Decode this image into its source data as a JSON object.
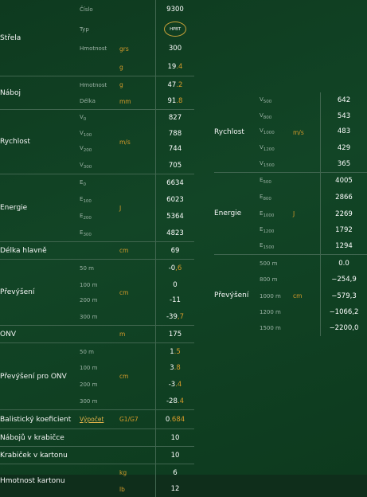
{
  "left": {
    "projectile": {
      "label": "Střela",
      "rows": [
        {
          "param": "Číslo",
          "unit": "",
          "value": "9300"
        },
        {
          "param": "Typ",
          "unit": "",
          "badge": "HPBT"
        },
        {
          "param": "Hmotnost",
          "unit": "grs",
          "value": "300"
        },
        {
          "param": "",
          "unit": "g",
          "int": "19",
          "dec": ".4"
        }
      ]
    },
    "cartridge": {
      "label": "Náboj",
      "rows": [
        {
          "param": "Hmotnost",
          "unit": "g",
          "int": "47",
          "dec": ".2"
        },
        {
          "param": "Délka",
          "unit": "mm",
          "int": "91",
          "dec": ".8"
        }
      ]
    },
    "velocity": {
      "label": "Rychlost",
      "unit": "m/s",
      "rows": [
        {
          "p": "V",
          "s": "0",
          "value": "827"
        },
        {
          "p": "V",
          "s": "100",
          "value": "788"
        },
        {
          "p": "V",
          "s": "200",
          "value": "744"
        },
        {
          "p": "V",
          "s": "300",
          "value": "705"
        }
      ]
    },
    "energy": {
      "label": "Energie",
      "unit": "J",
      "rows": [
        {
          "p": "E",
          "s": "0",
          "value": "6634"
        },
        {
          "p": "E",
          "s": "100",
          "value": "6023"
        },
        {
          "p": "E",
          "s": "200",
          "value": "5364"
        },
        {
          "p": "E",
          "s": "300",
          "value": "4823"
        }
      ]
    },
    "barrel": {
      "label": "Délka hlavně",
      "unit": "cm",
      "value": "69"
    },
    "drop": {
      "label": "Převýšení",
      "unit": "cm",
      "rows": [
        {
          "param": "50 m",
          "int": "-0",
          "dec": ",6"
        },
        {
          "param": "100 m",
          "int": "0",
          "dec": ""
        },
        {
          "param": "200 m",
          "int": "-11",
          "dec": ""
        },
        {
          "param": "300 m",
          "int": "-39",
          "dec": ",7"
        }
      ]
    },
    "onv": {
      "label": "ONV",
      "unit": "m",
      "value": "175"
    },
    "drop_onv": {
      "label": "Převýšení pro ONV",
      "unit": "cm",
      "rows": [
        {
          "param": "50 m",
          "int": "1",
          "dec": ".5"
        },
        {
          "param": "100 m",
          "int": "3",
          "dec": ".8"
        },
        {
          "param": "200 m",
          "int": "-3",
          "dec": ".4"
        },
        {
          "param": "300 m",
          "int": "-28",
          "dec": ".4"
        }
      ]
    },
    "bc": {
      "label": "Balistický koeficient",
      "link": "Výpočet",
      "unit": "G1/G7",
      "int": "0",
      "dec": ".684"
    },
    "per_box": {
      "label": "Nábojů v krabičce",
      "value": "10"
    },
    "per_carton": {
      "label": "Krabiček v kartonu",
      "value": "10"
    },
    "carton_weight": {
      "label": "Hmotnost kartonu",
      "rows": [
        {
          "unit": "kg",
          "value": "6"
        },
        {
          "unit": "lb",
          "value": "12"
        }
      ]
    }
  },
  "right": {
    "velocity": {
      "label": "Rychlost",
      "unit": "m/s",
      "rows": [
        {
          "p": "V",
          "s": "500",
          "value": "642"
        },
        {
          "p": "V",
          "s": "800",
          "value": "543"
        },
        {
          "p": "V",
          "s": "1000",
          "value": "483"
        },
        {
          "p": "V",
          "s": "1200",
          "value": "429"
        },
        {
          "p": "V",
          "s": "1500",
          "value": "365"
        }
      ]
    },
    "energy": {
      "label": "Energie",
      "unit": "J",
      "rows": [
        {
          "p": "E",
          "s": "500",
          "value": "4005"
        },
        {
          "p": "E",
          "s": "800",
          "value": "2866"
        },
        {
          "p": "E",
          "s": "1000",
          "value": "2269"
        },
        {
          "p": "E",
          "s": "1200",
          "value": "1792"
        },
        {
          "p": "E",
          "s": "1500",
          "value": "1294"
        }
      ]
    },
    "drop": {
      "label": "Převýšení",
      "unit": "cm",
      "rows": [
        {
          "param": "500 m",
          "value": "0.0"
        },
        {
          "param": "800 m",
          "value": "−254,9"
        },
        {
          "param": "1000 m",
          "value": "−579,3"
        },
        {
          "param": "1200 m",
          "value": "−1066,2"
        },
        {
          "param": "1500 m",
          "value": "−2200,0"
        }
      ]
    }
  },
  "colors": {
    "background": "#124526",
    "label": "#f5f5f5",
    "param": "#9db3a6",
    "unit_accent": "#d79b2a",
    "border": "#40664f"
  }
}
